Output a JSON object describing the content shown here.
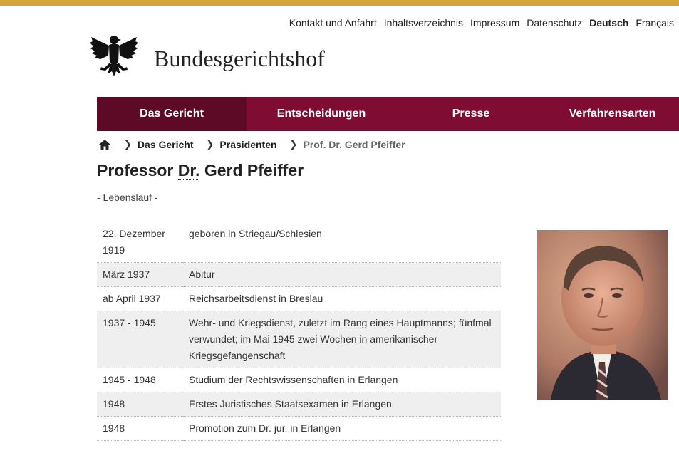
{
  "meta_nav": [
    {
      "label": "Kontakt und Anfahrt"
    },
    {
      "label": "Inhaltsverzeichnis"
    },
    {
      "label": "Impressum"
    },
    {
      "label": "Datenschutz"
    },
    {
      "label": "Deutsch"
    },
    {
      "label": "Français"
    }
  ],
  "site": {
    "title": "Bundesgerichtshof"
  },
  "main_nav": [
    {
      "label": "Das Gericht"
    },
    {
      "label": "Entscheidungen"
    },
    {
      "label": "Presse"
    },
    {
      "label": "Verfahrensarten"
    }
  ],
  "breadcrumb": {
    "home_icon": "home-icon",
    "items": [
      {
        "label": "Das Gericht"
      },
      {
        "label": "Präsidenten"
      },
      {
        "label": "Prof. Dr. Gerd Pfeiffer"
      }
    ]
  },
  "page": {
    "title_pre": "Professor ",
    "title_abbr": "Dr.",
    "title_post": " Gerd Pfeiffer",
    "subtitle": "- Lebenslauf -"
  },
  "cv": [
    {
      "date": "22. Dezember 1919",
      "event": "geboren in Striegau/Schlesien"
    },
    {
      "date": "März 1937",
      "event": "Abitur"
    },
    {
      "date": "ab April 1937",
      "event": "Reichsarbeitsdienst in Breslau"
    },
    {
      "date": "1937 - 1945",
      "event": "Wehr- und Kriegsdienst, zuletzt im Rang eines Hauptmanns; fünfmal verwundet; im Mai 1945 zwei Wochen in amerikanischer Kriegsgefangenschaft"
    },
    {
      "date": "1945 - 1948",
      "event": "Studium der Rechtswissenschaften in Erlangen"
    },
    {
      "date": "1948",
      "event": "Erstes Juristisches Staatsexamen in Erlangen"
    },
    {
      "date": "1948",
      "event": "Promotion zum Dr. jur. in Erlangen"
    }
  ],
  "colors": {
    "accent_gold": "#d4a63a",
    "nav_bg": "#7f0d33",
    "nav_active": "#5d0a26"
  }
}
